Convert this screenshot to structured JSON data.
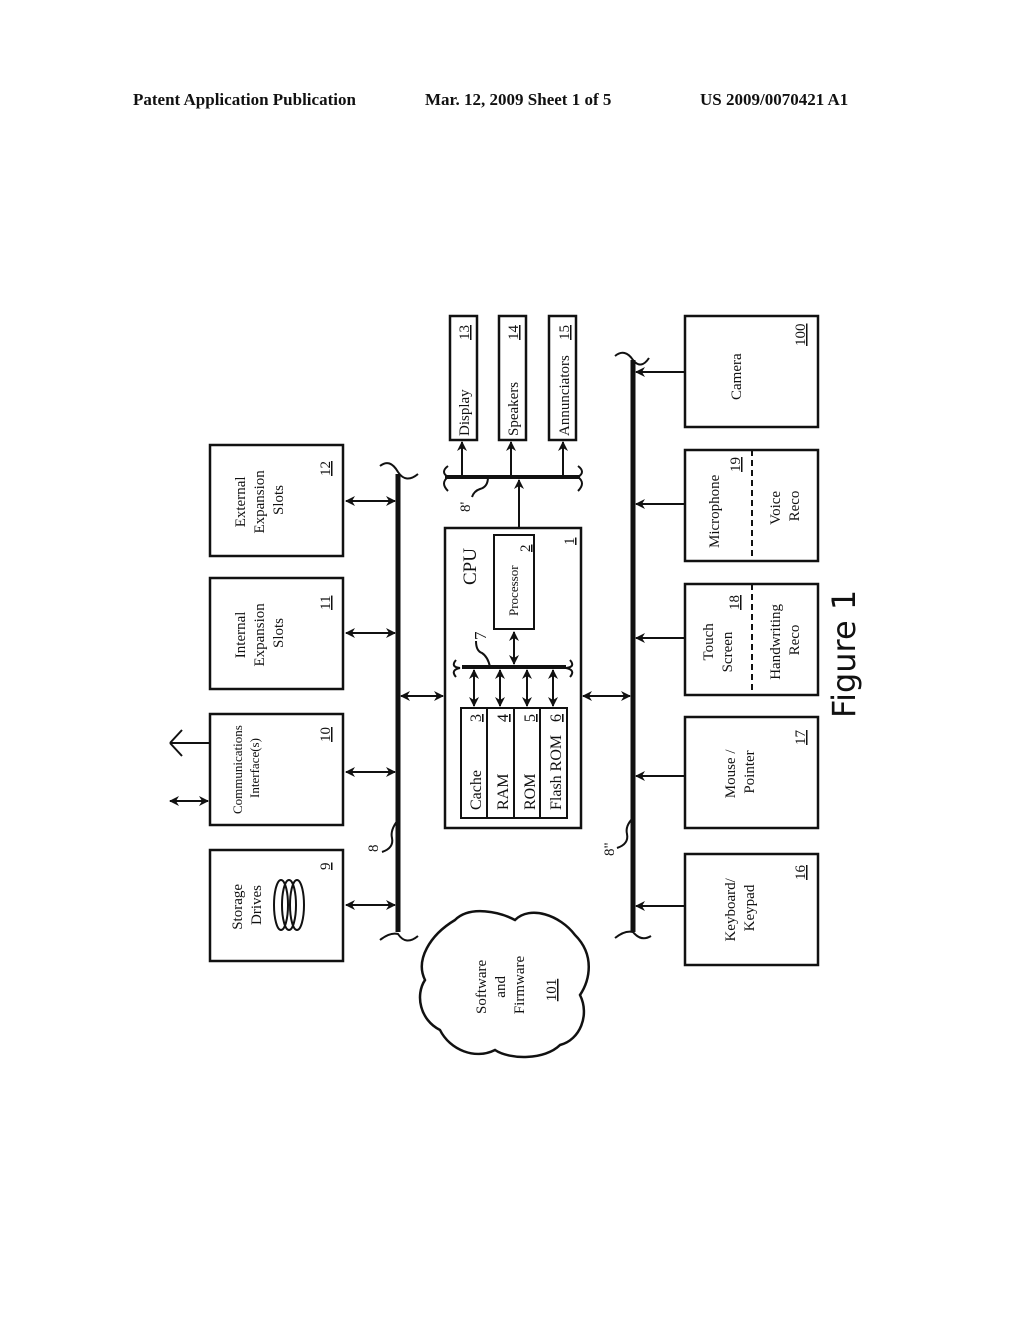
{
  "header": {
    "publication": "Patent Application Publication",
    "date_sheet": "Mar. 12, 2009  Sheet 1 of 5",
    "patent_number": "US 2009/0070421 A1"
  },
  "figure": {
    "label": "Figure 1",
    "buses": {
      "main": "8",
      "output": "8'",
      "input": "8\"",
      "internal": "7"
    },
    "top_row": [
      {
        "id": "storage",
        "lines": [
          "Storage",
          "Drives"
        ],
        "num": "9",
        "icon": "disk-stack-icon"
      },
      {
        "id": "comms",
        "lines": [
          "Communications",
          "Interface(s)"
        ],
        "num": "10",
        "icon": "antenna-icon"
      },
      {
        "id": "internal-slots",
        "lines": [
          "Internal",
          "Expansion",
          "Slots"
        ],
        "num": "11"
      },
      {
        "id": "external-slots",
        "lines": [
          "External",
          "Expansion",
          "Slots"
        ],
        "num": "12"
      }
    ],
    "outputs": [
      {
        "id": "display",
        "label": "Display",
        "num": "13"
      },
      {
        "id": "speakers",
        "label": "Speakers",
        "num": "14"
      },
      {
        "id": "annunciators",
        "label": "Annunciators",
        "num": "15"
      }
    ],
    "cpu": {
      "label": "CPU",
      "num": "1",
      "processor": {
        "label": "Processor",
        "num": "2"
      },
      "memory": [
        {
          "label": "Cache",
          "num": "3"
        },
        {
          "label": "RAM",
          "num": "4"
        },
        {
          "label": "ROM",
          "num": "5"
        },
        {
          "label": "Flash ROM",
          "num": "6"
        }
      ]
    },
    "inputs": [
      {
        "id": "keyboard",
        "lines": [
          "Keyboard/",
          "Keypad"
        ],
        "num": "16"
      },
      {
        "id": "mouse",
        "lines": [
          "Mouse /",
          "Pointer"
        ],
        "num": "17"
      },
      {
        "id": "touch",
        "lines": [
          "Touch",
          "Screen"
        ],
        "num": "18",
        "sub": [
          "Handwriting",
          "Reco"
        ]
      },
      {
        "id": "mic",
        "lines": [
          "Microphone"
        ],
        "num": "19",
        "sub": [
          "Voice",
          "Reco"
        ]
      },
      {
        "id": "camera",
        "lines": [
          "Camera"
        ],
        "num": "100"
      }
    ],
    "software": {
      "lines": [
        "Software",
        "and",
        "Firmware"
      ],
      "num": "101"
    }
  }
}
